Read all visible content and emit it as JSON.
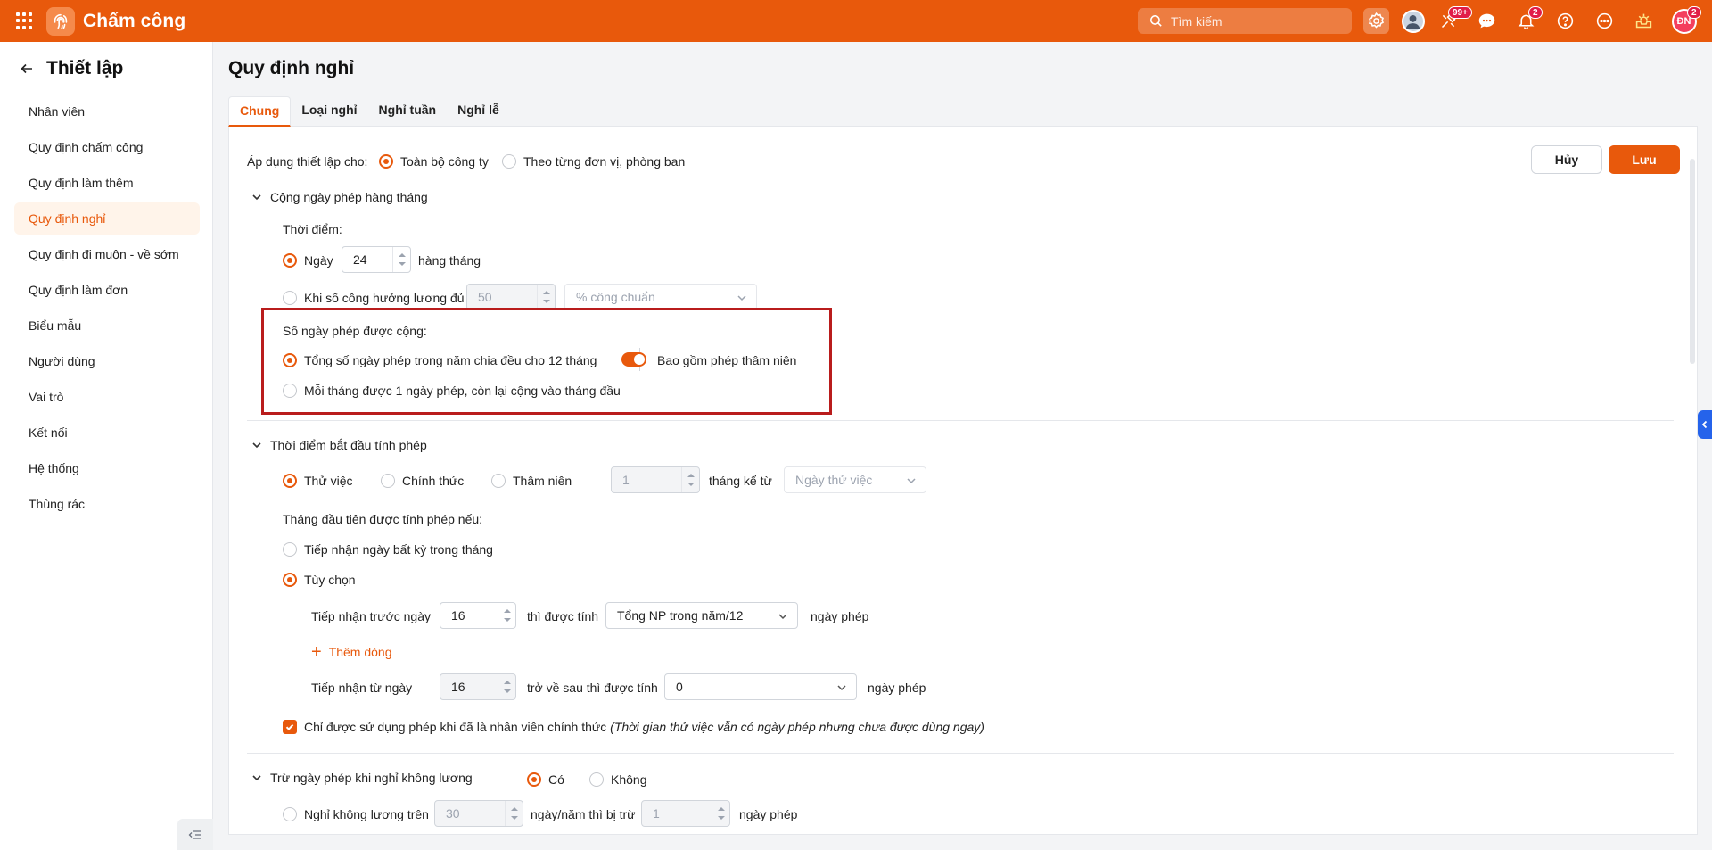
{
  "app": {
    "title": "Chấm công"
  },
  "search": {
    "placeholder": "Tìm kiếm"
  },
  "topbar": {
    "badge_updates": "99+",
    "badge_notifications": "2",
    "user_initials": "ĐN",
    "user_badge": "2"
  },
  "sidebar": {
    "title": "Thiết lập",
    "items": [
      "Nhân viên",
      "Quy định chấm công",
      "Quy định làm thêm",
      "Quy định nghỉ",
      "Quy định đi muộn - về sớm",
      "Quy định làm đơn",
      "Biểu mẫu",
      "Người dùng",
      "Vai trò",
      "Kết nối",
      "Hệ thống",
      "Thùng rác"
    ],
    "active_index": 3
  },
  "page": {
    "title": "Quy định nghỉ"
  },
  "tabs": [
    "Chung",
    "Loại nghỉ",
    "Nghỉ tuần",
    "Nghỉ lễ"
  ],
  "apply": {
    "label": "Áp dụng thiết lập cho:",
    "opt_company": "Toàn bộ công ty",
    "opt_units": "Theo từng đơn vị, phòng ban"
  },
  "actions": {
    "cancel": "Hủy",
    "save": "Lưu"
  },
  "monthly": {
    "section_title": "Cộng ngày phép hàng tháng",
    "time_label": "Thời điểm:",
    "day_label": "Ngày",
    "day_value": "24",
    "day_suffix": "hàng tháng",
    "when_label": "Khi số công hưởng lương đủ",
    "when_value": "50",
    "when_unit": "% công chuẩn",
    "count_label": "Số ngày phép được cộng:",
    "opt_total": "Tổng số ngày phép trong năm chia đều cho 12 tháng",
    "include_seniority": "Bao gồm phép thâm niên",
    "opt_one_per_month": "Mỗi tháng được 1 ngày phép, còn lại cộng vào tháng đầu"
  },
  "start": {
    "section_title": "Thời điểm bắt đầu tính phép",
    "opt_probation": "Thử việc",
    "opt_official": "Chính thức",
    "opt_seniority": "Thâm niên",
    "months_value": "1",
    "months_from": "tháng kể từ",
    "from_value": "Ngày thử việc",
    "first_month_label": "Tháng đầu tiên được tính phép nếu:",
    "opt_any_day": "Tiếp nhận ngày bất kỳ trong tháng",
    "opt_custom": "Tùy chọn",
    "before_label": "Tiếp nhận trước ngày",
    "before_value": "16",
    "before_mid": "thì được tính",
    "before_select": "Tổng NP trong năm/12",
    "before_suffix": "ngày phép",
    "add_row": "Thêm dòng",
    "from_day_label": "Tiếp nhận từ ngày",
    "from_day_value": "16",
    "from_day_mid": "trở về sau thì được tính",
    "from_day_select": "0",
    "from_day_suffix": "ngày phép",
    "official_only": "Chỉ được sử dụng phép khi đã là nhân viên chính thức",
    "official_only_note": "(Thời gian thử việc vẫn có ngày phép nhưng chưa được dùng ngay)"
  },
  "unpaid": {
    "section_title": "Trừ ngày phép khi nghỉ không lương",
    "opt_yes": "Có",
    "opt_no": "Không",
    "over_label": "Nghỉ không lương trên",
    "over_value": "30",
    "over_mid": "ngày/năm thì bị trừ",
    "deduct_value": "1",
    "deduct_suffix": "ngày phép"
  },
  "colors": {
    "brand": "#e8590c",
    "highlight": "#b91c1c",
    "active_bg": "#fff4ea"
  }
}
